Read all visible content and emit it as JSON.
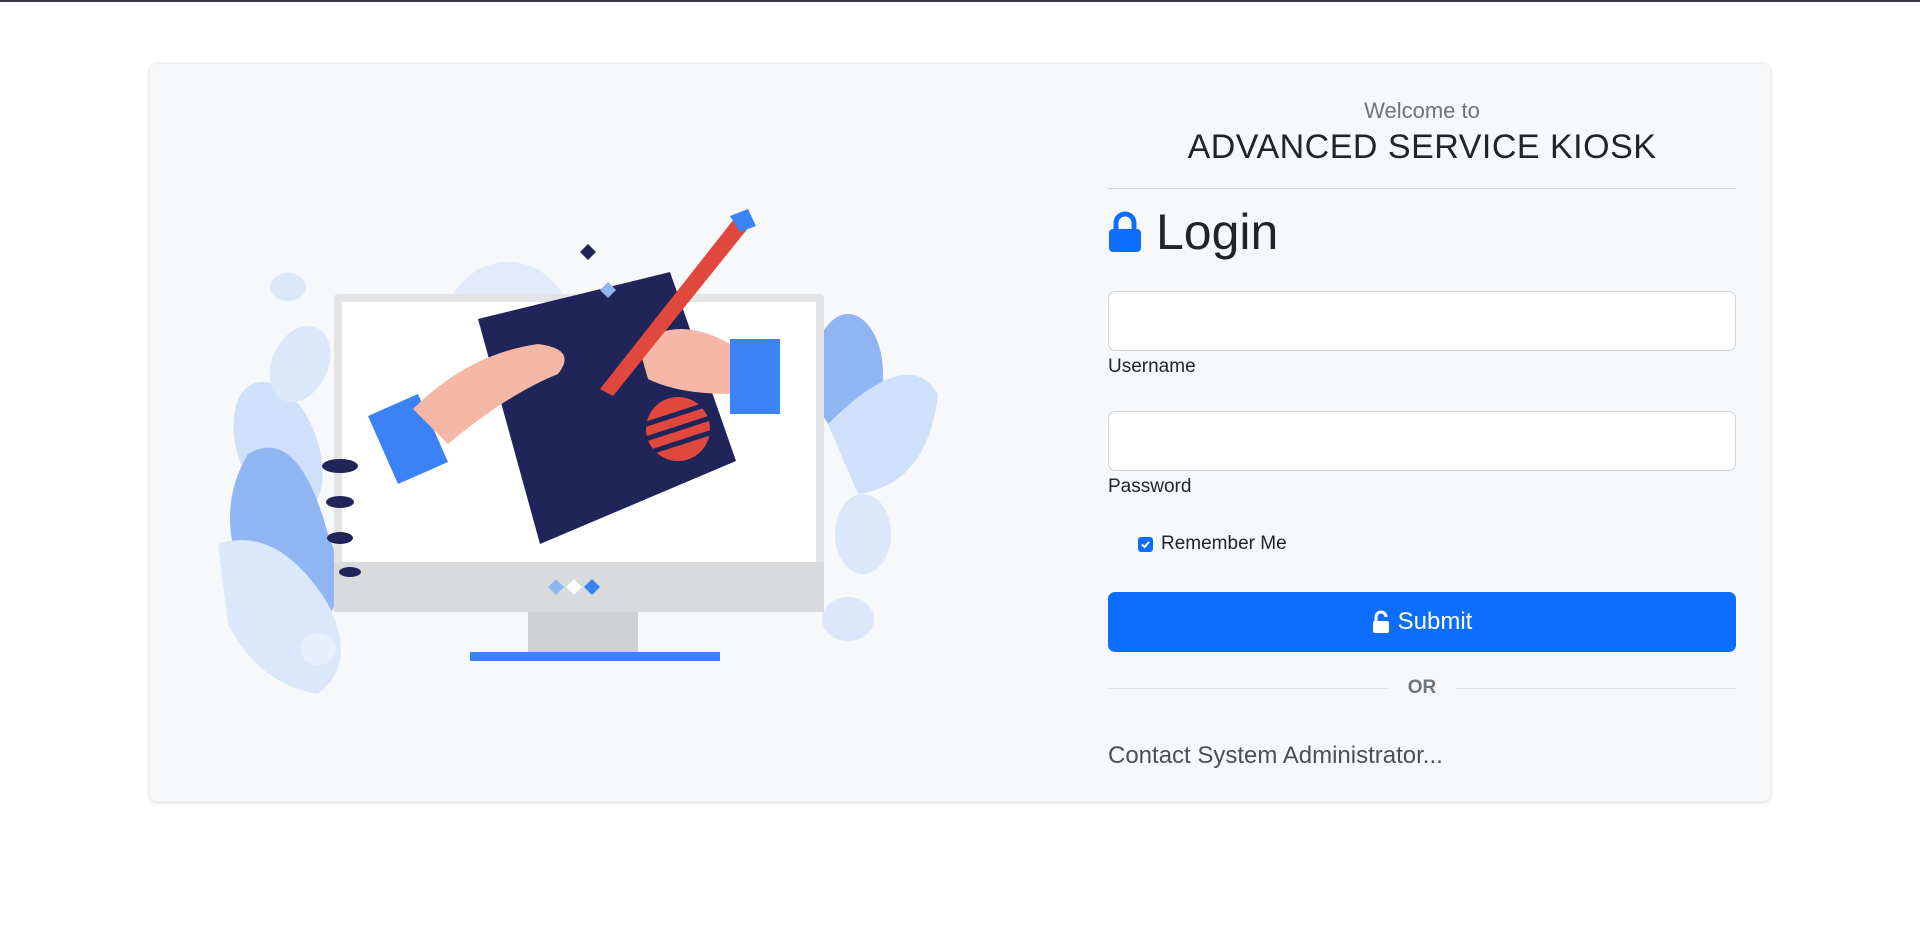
{
  "header": {
    "welcome": "Welcome to",
    "app_title": "ADVANCED SERVICE KIOSK"
  },
  "login": {
    "heading": "Login",
    "username_label": "Username",
    "username_value": "",
    "password_label": "Password",
    "password_value": "",
    "remember_label": "Remember Me",
    "remember_checked": true,
    "submit_label": "Submit",
    "or_text": "OR",
    "contact_text": "Contact System Administrator..."
  },
  "icons": {
    "heading_icon": "lock-icon",
    "submit_icon": "unlock-icon"
  },
  "colors": {
    "primary": "#0d6efd",
    "card_bg": "#f7f8f9",
    "navy": "#1f2459",
    "red": "#e0473d",
    "light_blue": "#8fb6f2",
    "skin": "#f6b8a6"
  }
}
